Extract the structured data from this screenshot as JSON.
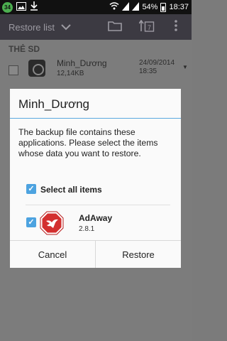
{
  "status_bar": {
    "badge": "34",
    "battery": "54%",
    "time": "18:37"
  },
  "toolbar": {
    "title": "Restore list",
    "icons": [
      "chevron-down-icon",
      "folder-icon",
      "calendar-sort-icon",
      "more-vert-icon"
    ]
  },
  "list": {
    "section_header": "THẺ SD",
    "rows": [
      {
        "name": "Minh_Dương",
        "size": "12,14KB",
        "date": "24/09/2014",
        "time": "18:35"
      }
    ]
  },
  "dialog": {
    "title": "Minh_Dương",
    "message": "The backup file contains these applications. Please select the items whose data you want to restore.",
    "select_all_label": "Select all items",
    "select_all_checked": true,
    "apps": [
      {
        "name": "AdAway",
        "version": "2.8.1",
        "checked": true,
        "icon": "adaway-icon"
      }
    ],
    "cancel_label": "Cancel",
    "restore_label": "Restore"
  },
  "colors": {
    "accent": "#4da3e0",
    "toolbar_bg": "#3c3a42",
    "dim_bg": "#7b7b7b",
    "adaway_red": "#d32f2f"
  }
}
